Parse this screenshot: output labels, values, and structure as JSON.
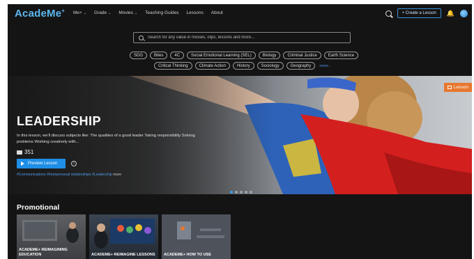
{
  "brand": {
    "logo": "AcadeMe",
    "logo_mark": "+"
  },
  "nav": {
    "menu": [
      {
        "label": "Me+",
        "dropdown": true
      },
      {
        "label": "Grade",
        "dropdown": true
      },
      {
        "label": "Movies",
        "dropdown": true
      },
      {
        "label": "Teaching Guides",
        "dropdown": false
      },
      {
        "label": "Lessons",
        "dropdown": false
      },
      {
        "label": "About",
        "dropdown": false
      }
    ],
    "create_label": "+ Create a Lesson",
    "search_icon": "search-icon",
    "bell_icon": "bell-icon"
  },
  "search": {
    "placeholder": "Search for any value in movies, clips, lessons and more...",
    "value": ""
  },
  "tags": {
    "row1": [
      "SDG",
      "Bites",
      "4C",
      "Social Emotional Learning (SEL)",
      "Biology",
      "Criminal Justice",
      "Earth Science"
    ],
    "row2": [
      "Critical Thinking",
      "Climate Action",
      "History",
      "Sociology",
      "Geography"
    ],
    "more_label": "more..."
  },
  "hero": {
    "badge": "Lesson",
    "title": "LEADERSHIP",
    "description": "In this lesson, we'll discuss subjects like: The qualities of a good leader Taking responsibility Solving problems Working creatively with...",
    "views": "351",
    "preview_label": "Preview Lesson",
    "info_glyph": "i",
    "hashtags": "#Communications #Interpersonal relationships #Leadership",
    "hashtags_more": "more",
    "slides": 5,
    "active_slide": 0
  },
  "promo": {
    "title": "Promotional",
    "cards": [
      {
        "label": "ACADEME+ REIMAGINING EDUCATION"
      },
      {
        "label": "ACADEME+ REIMAGINE LESSONS"
      },
      {
        "label": "ACADEME+ HOW TO USE"
      }
    ]
  },
  "colors": {
    "accent": "#1e8ee6",
    "badge": "#e8772e",
    "cape": "#d41f1f",
    "background": "#141414"
  }
}
